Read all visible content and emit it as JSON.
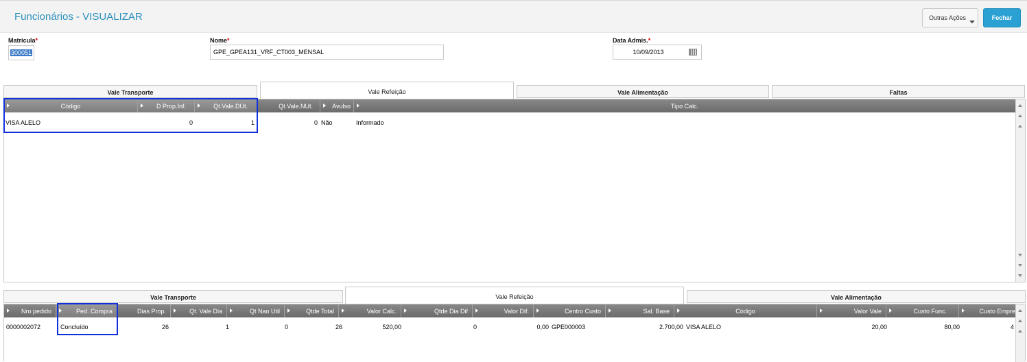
{
  "header": {
    "title": "Funcionários - VISUALIZAR",
    "outras_acoes": "Outras Ações",
    "fechar": "Fechar"
  },
  "form": {
    "matricula_label": "Matricula",
    "matricula_value": "300051",
    "nome_label": "Nome",
    "nome_value": "GPE_GPEA131_VRF_CT003_MENSAL",
    "data_label": "Data Admis.",
    "data_value": "10/09/2013",
    "required_mark": "*"
  },
  "top_tabs": [
    "Vale Transporte",
    "Vale Refeição",
    "Vale Alimentação",
    "Faltas"
  ],
  "top_grid": {
    "columns": [
      "Código",
      "D Prop.Inf.",
      "Qt.Vale.DUt.",
      "Qt.Vale.NUt.",
      "Avulso",
      "Tipo Calc."
    ],
    "rows": [
      [
        "VISA ALELO",
        "0",
        "1",
        "0",
        "Não",
        "Informado"
      ]
    ]
  },
  "bottom_tabs": [
    "Vale Transporte",
    "Vale Refeição",
    "Vale Alimentação"
  ],
  "bottom_grid": {
    "columns": [
      "Nro pedido",
      "Ped. Compra",
      "Dias Prop.",
      "Qt. Vale Dia",
      "Qt Nao Util",
      "Qtde Total",
      "Valor Calc.",
      "Qtde Dia Dif",
      "Valor Dif.",
      "Centro Custo",
      "Sal. Base",
      "Código",
      "Valor Vale",
      "Custo Func.",
      "Custo Empre"
    ],
    "rows": [
      [
        "0000002072",
        "Concluído",
        "26",
        "1",
        "0",
        "26",
        "520,00",
        "0",
        "0,00",
        "GPE000003",
        "2.700,00",
        "VISA ALELO",
        "20,00",
        "80,00",
        "4"
      ]
    ]
  },
  "colors": {
    "title": "#2a8fbd",
    "primary_button": "#2aa1d2",
    "highlight_box": "#1030e0"
  }
}
